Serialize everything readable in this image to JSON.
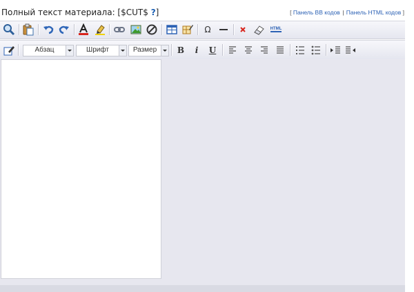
{
  "header": {
    "label_prefix": "Полный текст материала: [$CUT$ ",
    "help_mark": "?",
    "label_suffix": "]",
    "links": {
      "open_bracket": "[",
      "bb_panel": "Панель BB кодов",
      "separator": "|",
      "html_panel": "Панель HTML кодов",
      "close_bracket": "]"
    }
  },
  "toolbar2": {
    "paragraph_dropdown": "Абзац",
    "font_dropdown": "Шрифт",
    "size_dropdown": "Размер",
    "bold": "B",
    "italic": "i",
    "underline": "U"
  },
  "toolbar1": {
    "omega_symbol": "Ω",
    "html_badge": "HTML"
  },
  "colors": {
    "link": "#2d62b5",
    "toolbar_bg": "#e5e6ef",
    "panel_bg": "#e7e7ef"
  }
}
